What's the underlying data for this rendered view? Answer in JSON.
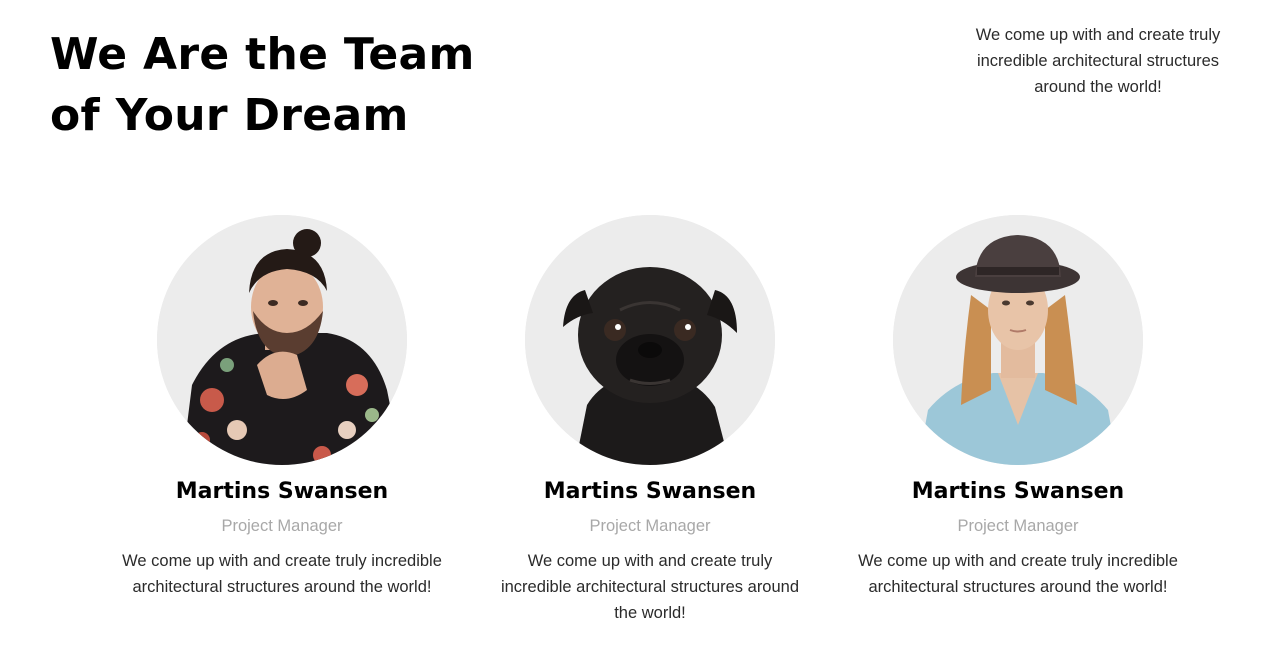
{
  "header": {
    "title_line_1": "We Are the Team",
    "title_line_2": "of Your Dream",
    "intro": "We come up with and create truly incredible architectural structures around the world!"
  },
  "team": [
    {
      "photo": "man-with-topknot-portrait",
      "name": "Martins Swansen",
      "role": "Project Manager",
      "bio": "We come up with and create truly incredible architectural structures around the world!"
    },
    {
      "photo": "black-pug-portrait",
      "name": "Martins Swansen",
      "role": "Project Manager",
      "bio": "We come up with and create truly incredible architectural structures around the world!"
    },
    {
      "photo": "woman-with-hat-portrait",
      "name": "Martins Swansen",
      "role": "Project Manager",
      "bio": "We come up with and create truly incredible architectural structures around the world!"
    }
  ]
}
